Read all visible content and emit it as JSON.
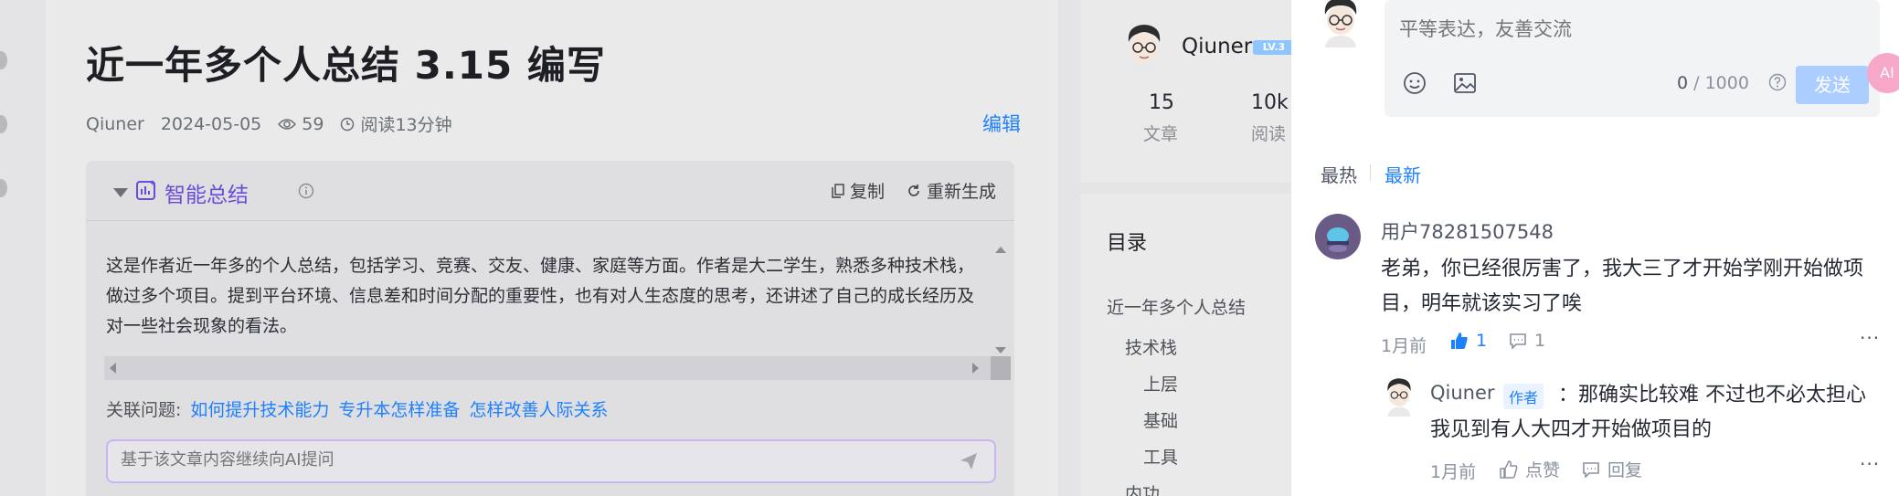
{
  "article": {
    "title": "近一年多个人总结 3.15 编写",
    "author": "Qiuner",
    "date": "2024-05-05",
    "views": "59",
    "read_time": "阅读13分钟",
    "edit_label": "编辑"
  },
  "ai_summary": {
    "title": "智能总结",
    "copy_label": "复制",
    "regenerate_label": "重新生成",
    "text": "这是作者近一年多的个人总结，包括学习、竞赛、交友、健康、家庭等方面。作者是大二学生，熟悉多种技术栈，做过多个项目。提到平台环境、信息差和时间分配的重要性，也有对人生态度的思考，还讲述了自己的成长经历及对一些社会现象的看法。",
    "related_label": "关联问题:",
    "related_questions": [
      "如何提升技术能力",
      "专升本怎样准备",
      "怎样改善人际关系"
    ],
    "ask_placeholder": "基于该文章内容继续向AI提问"
  },
  "author_card": {
    "name": "Qiuner",
    "level": "LV.3",
    "stats": [
      {
        "num": "15",
        "label": "文章"
      },
      {
        "num": "10k",
        "label": "阅读"
      }
    ]
  },
  "toc": {
    "title": "目录",
    "items": [
      "近一年多个人总结",
      "技术栈",
      "上层",
      "基础",
      "工具",
      "内功"
    ]
  },
  "comments": {
    "input_placeholder": "平等表达，友善交流",
    "count": "0",
    "limit": "/ 1000",
    "send_label": "发送",
    "float_label": "AI",
    "sort_hot": "最热",
    "sort_new": "最新",
    "list": [
      {
        "user": "用户78281507548",
        "text": "老弟，你已经很厉害了，我大三了才开始学刚开始做项目，明年就该实习了唉",
        "time": "1月前",
        "likes": "1",
        "replies": "1",
        "more": "···",
        "reply": {
          "user": "Qiuner",
          "tag": "作者",
          "text": "：那确实比较难 不过也不必太担心 我见到有人大四才开始做项目的",
          "time": "1月前",
          "like_label": "点赞",
          "reply_label": "回复",
          "more": "···"
        }
      }
    ]
  },
  "colors": {
    "accent": "#1e80ff",
    "ai_purple": "#6a4cd8",
    "send_disabled": "#abcdff"
  }
}
